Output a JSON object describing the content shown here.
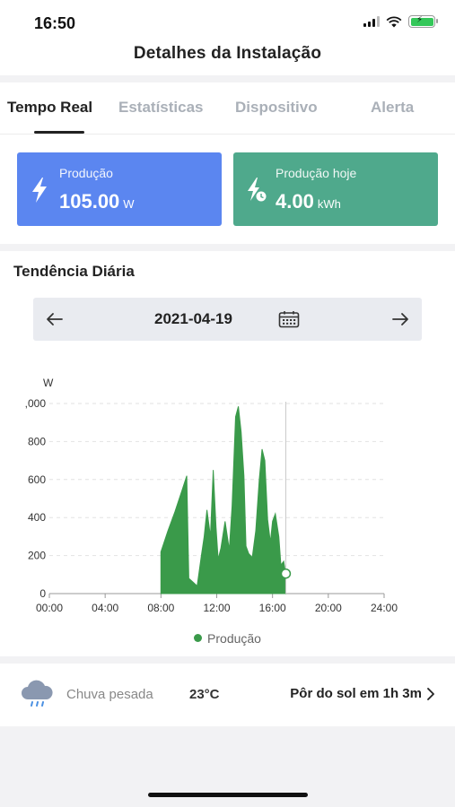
{
  "status_bar": {
    "time": "16:50"
  },
  "header": {
    "title": "Detalhes da Instalação"
  },
  "tabs": [
    {
      "label": "Tempo Real",
      "active": true
    },
    {
      "label": "Estatísticas",
      "active": false
    },
    {
      "label": "Dispositivo",
      "active": false
    },
    {
      "label": "Alerta",
      "active": false
    }
  ],
  "cards": {
    "production": {
      "label": "Produção",
      "value": "105.00",
      "unit": "W",
      "color": "#5b86f0",
      "icon": "lightning-icon"
    },
    "production_today": {
      "label": "Produção hoje",
      "value": "4.00",
      "unit": "kWh",
      "color": "#4fa98c",
      "icon": "lightning-clock-icon"
    }
  },
  "trend": {
    "title": "Tendência Diária",
    "date": "2021-04-19",
    "prev_icon": "arrow-left-icon",
    "next_icon": "arrow-right-icon",
    "calendar_icon": "calendar-icon"
  },
  "chart_data": {
    "type": "area",
    "ylabel": "W",
    "ylim": [
      0,
      1000
    ],
    "yticks": [
      ",000",
      "800",
      "600",
      "400",
      "200",
      "0"
    ],
    "xticks": [
      "00:00",
      "04:00",
      "08:00",
      "12:00",
      "16:00",
      "20:00",
      "24:00"
    ],
    "xlim_hours": [
      0,
      24
    ],
    "series": [
      {
        "name": "Produção",
        "color": "#3a9a4a",
        "points": [
          [
            8.0,
            0
          ],
          [
            8.0,
            220
          ],
          [
            8.5,
            330
          ],
          [
            9.0,
            430
          ],
          [
            9.5,
            540
          ],
          [
            9.85,
            620
          ],
          [
            10.0,
            80
          ],
          [
            10.3,
            60
          ],
          [
            10.6,
            40
          ],
          [
            10.9,
            200
          ],
          [
            11.1,
            300
          ],
          [
            11.3,
            440
          ],
          [
            11.55,
            300
          ],
          [
            11.75,
            650
          ],
          [
            11.95,
            350
          ],
          [
            12.1,
            180
          ],
          [
            12.3,
            240
          ],
          [
            12.6,
            380
          ],
          [
            12.9,
            230
          ],
          [
            13.1,
            460
          ],
          [
            13.35,
            930
          ],
          [
            13.55,
            985
          ],
          [
            13.75,
            850
          ],
          [
            13.95,
            620
          ],
          [
            14.1,
            250
          ],
          [
            14.3,
            210
          ],
          [
            14.55,
            190
          ],
          [
            14.8,
            330
          ],
          [
            15.05,
            600
          ],
          [
            15.25,
            760
          ],
          [
            15.45,
            700
          ],
          [
            15.65,
            390
          ],
          [
            15.85,
            270
          ],
          [
            16.0,
            380
          ],
          [
            16.2,
            420
          ],
          [
            16.45,
            300
          ],
          [
            16.6,
            150
          ],
          [
            16.8,
            170
          ],
          [
            16.95,
            105
          ],
          [
            16.95,
            0
          ]
        ]
      }
    ],
    "current_marker": {
      "x": 16.95,
      "y": 105
    },
    "grid": true,
    "legend": "bottom-center"
  },
  "weather": {
    "icon": "rain-cloud-icon",
    "description": "Chuva pesada",
    "temperature": "23°C",
    "sunset": "Pôr do sol em 1h 3m",
    "sunset_icon": "chevron-right-icon"
  }
}
